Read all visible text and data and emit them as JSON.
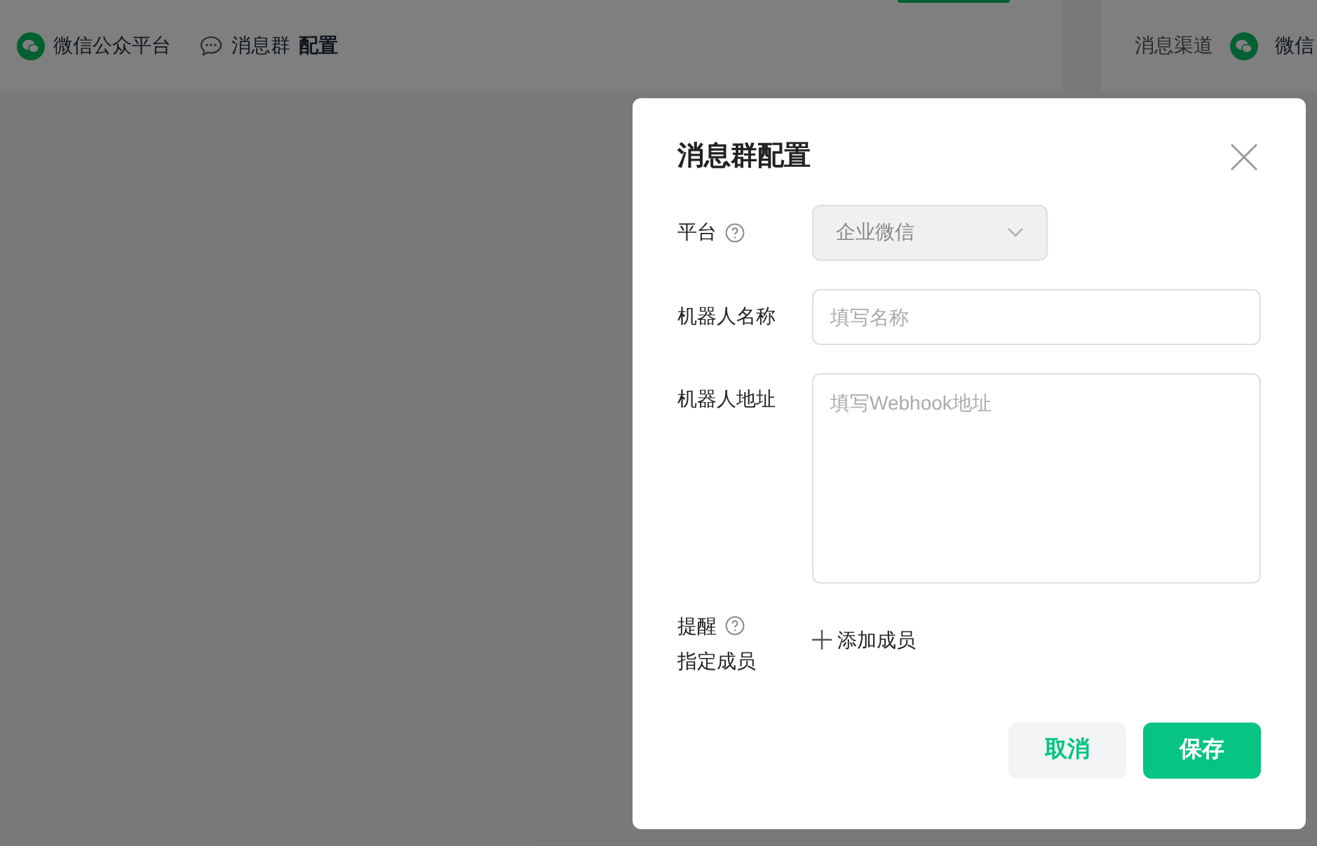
{
  "background": {
    "breadcrumb": [
      {
        "kind": "wechat",
        "label": "微信公众平台"
      },
      {
        "kind": "chat",
        "label": "消息群",
        "strong": "配置"
      }
    ],
    "right_panel": {
      "label": "消息渠道",
      "channel": "微信"
    }
  },
  "dialog": {
    "title": "消息群配置",
    "fields": [
      {
        "kind": "select",
        "label": "平台",
        "help": true,
        "value": "企业微信",
        "disabled": true
      },
      {
        "kind": "input",
        "label": "机器人名称",
        "help": false,
        "placeholder": "填写名称"
      },
      {
        "kind": "textarea",
        "label": "机器人地址",
        "help": false,
        "placeholder": "填写Webhook地址"
      },
      {
        "kind": "members",
        "label": "提醒",
        "label_line2": "指定成员",
        "help": true,
        "action": "添加成员"
      }
    ],
    "buttons": [
      {
        "kind": "secondary",
        "label": "取消"
      },
      {
        "kind": "primary",
        "label": "保存"
      }
    ]
  }
}
